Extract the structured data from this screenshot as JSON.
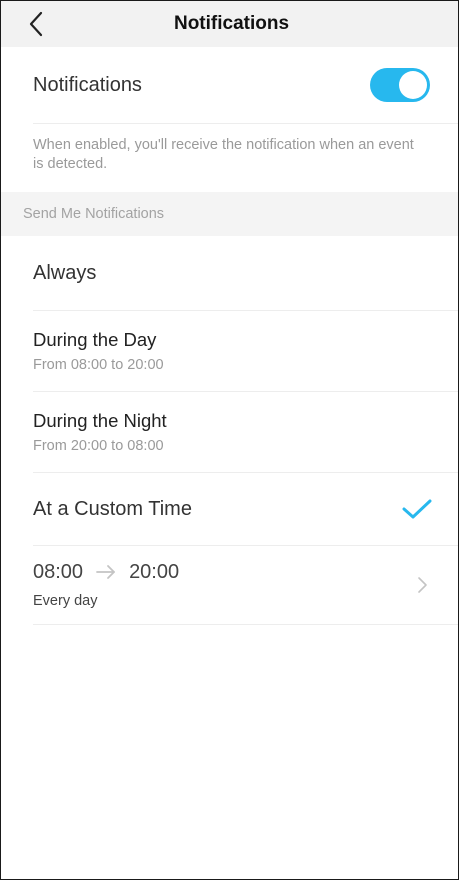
{
  "header": {
    "title": "Notifications"
  },
  "notifications": {
    "label": "Notifications",
    "enabled": true,
    "description": "When enabled, you'll receive the notification when an event is detected."
  },
  "section": {
    "title": "Send Me Notifications"
  },
  "options": [
    {
      "label": "Always",
      "sub": ""
    },
    {
      "label": "During the Day",
      "sub": "From 08:00 to 20:00"
    },
    {
      "label": "During the Night",
      "sub": "From 20:00 to 08:00"
    },
    {
      "label": "At a Custom Time",
      "sub": "",
      "selected": true
    }
  ],
  "custom_time": {
    "start": "08:00",
    "end": "20:00",
    "repeat": "Every day"
  },
  "colors": {
    "accent": "#27b8ee",
    "header_bg": "#f2f2f2",
    "section_bg": "#f4f4f4"
  }
}
